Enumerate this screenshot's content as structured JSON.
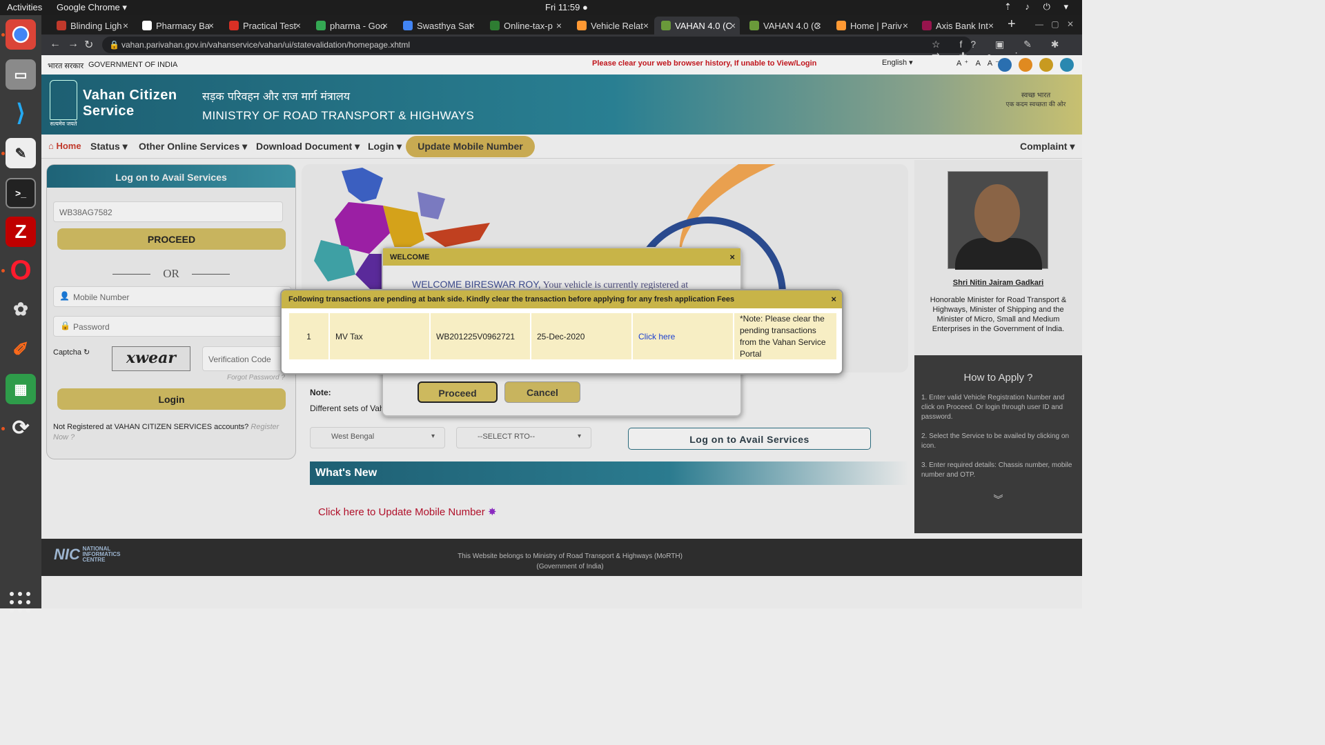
{
  "os": {
    "activities": "Activities",
    "app": "Google Chrome ▾",
    "clock": "Fri 11:59 ●",
    "tray": "⇡ ♪ ⏻ ▾"
  },
  "tabs": [
    {
      "label": "Blinding Ligh",
      "color": "#c0392b"
    },
    {
      "label": "Pharmacy Ba",
      "color": "#ffffff"
    },
    {
      "label": "Practical Test",
      "color": "#d93025"
    },
    {
      "label": "pharma - Goo",
      "color": "#34a853"
    },
    {
      "label": "Swasthya Sat",
      "color": "#4285f4"
    },
    {
      "label": "Online-tax-p",
      "color": "#2e7d32"
    },
    {
      "label": "Vehicle Relat",
      "color": "#ff9933"
    },
    {
      "label": "VAHAN 4.0 (C",
      "color": "#6a9a3a"
    },
    {
      "label": "VAHAN 4.0 (C",
      "color": "#6a9a3a"
    },
    {
      "label": "Home | Pariv",
      "color": "#ff9933"
    },
    {
      "label": "Axis Bank Int",
      "color": "#97144d"
    }
  ],
  "address": {
    "url": "vahan.parivahan.gov.in/vahanservice/vahan/ui/statevalidation/homepage.xhtml",
    "tools": "☆ f? ▣ ✎ ✱ ⇄ ✚ ● ⋮"
  },
  "govbar": {
    "hindi": "भारत सरकार",
    "english": "GOVERNMENT OF INDIA",
    "warning": "Please clear your web browser history, If unable to View/Login",
    "lang": "English ▾",
    "font_sizes": "A⁺ A A⁻"
  },
  "header": {
    "brand1": "Vahan Citizen",
    "brand2": "Service",
    "ministry_hi": "सड़क परिवहन और राज मार्ग मंत्रालय",
    "ministry_en": "MINISTRY OF ROAD TRANSPORT & HIGHWAYS",
    "emblem_text": "सत्यमेव जयते",
    "swach_text": "स्वच्छ भारत",
    "swach_sub": "एक कदम स्वच्छता की ओर"
  },
  "menu": {
    "home": "⌂ Home",
    "status": "Status ▾",
    "other": "Other Online Services ▾",
    "download": "Download Document ▾",
    "login": "Login ▾",
    "update": "Update Mobile Number",
    "complaint": "Complaint ▾"
  },
  "login_panel": {
    "title": "Log on to Avail Services",
    "reg_value": "WB38AG7582",
    "proceed": "PROCEED",
    "or": "OR",
    "mobile_ph": "Mobile Number",
    "password_ph": "Password",
    "captcha_label": "Captcha ↻",
    "captcha_text": "xwear",
    "verification_ph": "Verification Code",
    "forgot": "Forgot Password ?",
    "login": "Login",
    "not_registered": "Not Registered at VAHAN CITIZEN SERVICES accounts?",
    "register": "Register Now ?"
  },
  "main": {
    "note": "Note:",
    "diff": "Different sets of Vah",
    "state": "West Bengal",
    "rto": "--SELECT RTO--",
    "log_btn": "Log on to Avail Services",
    "whats_new": "What's New",
    "update_link": "Click here to Update Mobile Number"
  },
  "minister": {
    "name": "Shri Nitin Jairam Gadkari",
    "desc": "Honorable Minister for Road Transport & Highways, Minister of Shipping and the Minister of Micro, Small and Medium Enterprises in the Government of India."
  },
  "howto": {
    "title": "How to Apply ?",
    "steps": [
      "1. Enter valid Vehicle Registration Number and click on Proceed. Or login through user ID and password.",
      "2. Select the Service to be availed by clicking on icon.",
      "3. Enter required details: Chassis number, mobile number and OTP."
    ],
    "more": "︾"
  },
  "footer": {
    "nic_big": "NIC",
    "nic_line1": "NATIONAL",
    "nic_line2": "INFORMATICS",
    "nic_line3": "CENTRE",
    "text1": "This Website belongs to Ministry of Road Transport & Highways (MoRTH)",
    "text2": "(Government of India)"
  },
  "welcome_dialog": {
    "title": "WELCOME",
    "close": "×",
    "greeting_name": "WELCOME BIRESWAR ROY,",
    "greeting_rest": " Your vehicle is currently registered at",
    "proceed": "Proceed",
    "cancel": "Cancel"
  },
  "pending_dialog": {
    "title": "Following transactions are pending at bank side. Kindly clear the transaction before applying for any fresh application Fees",
    "close": "×",
    "row": {
      "sno": "1",
      "type": "MV Tax",
      "txn": "WB201225V0962721",
      "date": "25-Dec-2020",
      "link": "Click here",
      "note": "*Note: Please clear the pending transactions from the Vahan Service Portal"
    }
  }
}
